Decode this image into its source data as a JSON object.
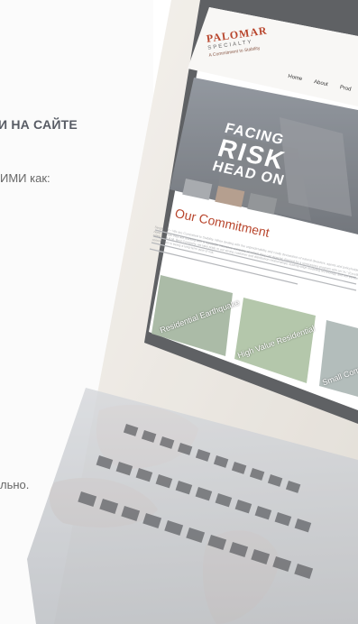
{
  "article": {
    "heading_fragment": "И НА САЙТЕ",
    "line1_fragment": "ИМИ как:",
    "line2_fragment": "льно."
  },
  "site": {
    "logo": {
      "name": "PALOMAR",
      "subtitle": "SPECIALTY",
      "tagline": "A Commitment to Stability"
    },
    "nav": {
      "home": "Home",
      "about": "About",
      "products": "Prod"
    },
    "hero": {
      "line1": "FACING",
      "line2": "RISK",
      "line3": "HEAD ON"
    },
    "commitment": {
      "title": "Our Commitment",
      "paragraph": "Simply put – We are Committed to Stability. When dealing with the unpredictability and costly devastation of natural disasters, agents and policyholders need to know they are working with a reputable insurance company on which they can depend. Backed by a reinsurance program with an “A-” (Excellent) rating from A.M. Best Company, we take pride in our strong customer and distribution relationships, leading-edge modeling technology, and our personal commitment to being a long-term view of risk."
    },
    "cards": [
      {
        "label": "Residential Earthquake"
      },
      {
        "label": "High Value Residential"
      },
      {
        "label": "Small Commercial"
      }
    ]
  },
  "colors": {
    "accent": "#b8452c",
    "hero_dark": "#3a3e44",
    "laptop_frame": "#2a2c30"
  }
}
